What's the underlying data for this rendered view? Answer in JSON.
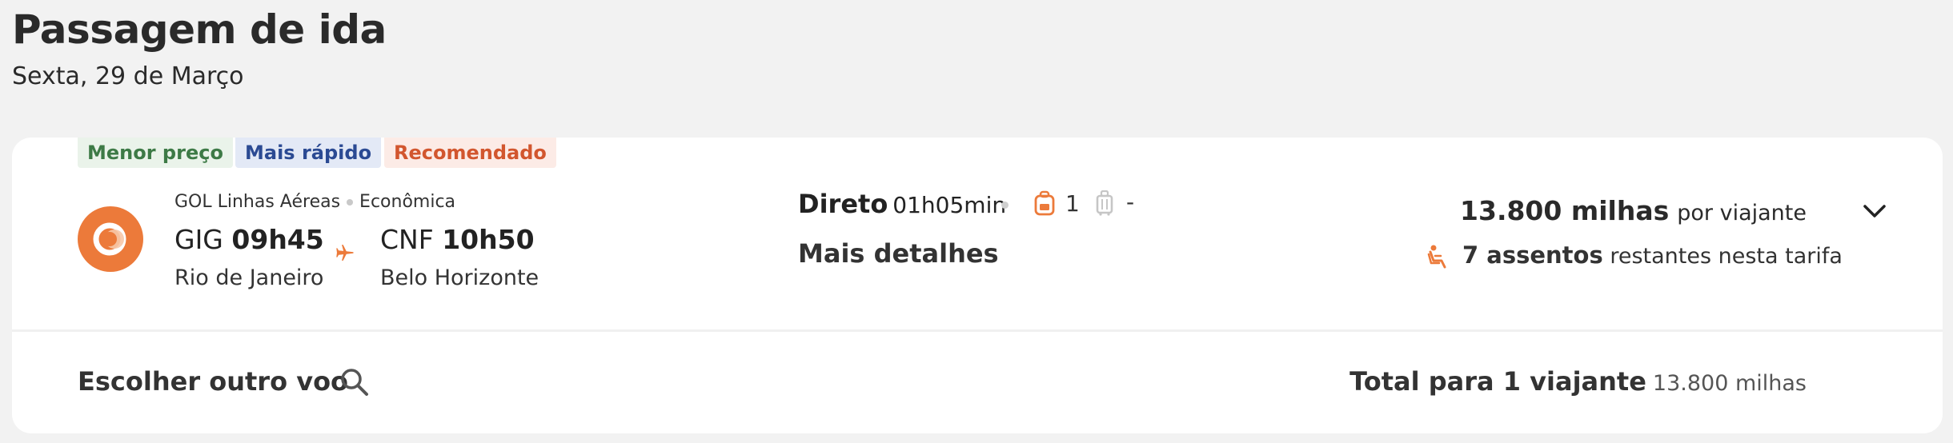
{
  "header": {
    "title": "Passagem de ida",
    "date": "Sexta, 29 de Março"
  },
  "flight": {
    "tags": {
      "cheapest": "Menor preço",
      "fastest": "Mais rápido",
      "recommended": "Recomendado"
    },
    "airline": "GOL Linhas Aéreas",
    "cabin": "Econômica",
    "logo_icon": "gol-logo-icon",
    "origin": {
      "code": "GIG",
      "time": "09h45",
      "city": "Rio de Janeiro"
    },
    "destination": {
      "code": "CNF",
      "time": "10h50",
      "city": "Belo Horizonte"
    },
    "stops": "Direto",
    "duration": "01h05min",
    "carry_on_count": "1",
    "checked_bag": "-",
    "details_link": "Mais detalhes",
    "price": "13.800 milhas",
    "price_suffix": "por viajante",
    "seats_count": "7 assentos",
    "seats_suffix": "restantes nesta tarifa"
  },
  "footer": {
    "other_flight": "Escolher outro voo",
    "total_label": "Total para 1 viajante",
    "total_value": "13.800 milhas"
  },
  "colors": {
    "accent": "#ec7a3a",
    "tag_green": "#3d7a46",
    "tag_blue": "#2b4a93",
    "tag_orange": "#d2562e"
  }
}
